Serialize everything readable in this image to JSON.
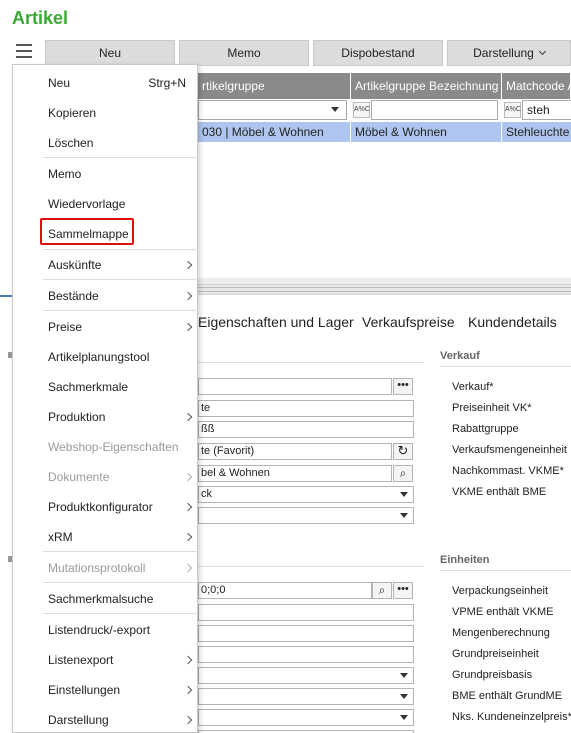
{
  "app": {
    "title": "Artikel"
  },
  "toolbar": {
    "buttons": [
      "Neu",
      "Memo",
      "Dispobestand",
      "Darstellung"
    ]
  },
  "grid": {
    "columns": [
      "rtikelgruppe",
      "Artikelgruppe Bezeichnung",
      "Matchcode Ar"
    ],
    "filter_prefix": "A%C",
    "filters": [
      "",
      "",
      "steh"
    ],
    "selected_row": [
      "030  |  Möbel & Wohnen",
      "Möbel & Wohnen",
      "Stehleuchte  ("
    ]
  },
  "tabs": [
    "Eigenschaften und Lager",
    "Verkaufspreise",
    "Kundendetails"
  ],
  "form": {
    "left_values": [
      "",
      "te",
      "ßß",
      "te  (Favorit)",
      "bel & Wohnen",
      "ck",
      "",
      "0;0;0",
      "",
      "",
      "",
      "",
      "",
      "",
      ""
    ],
    "verkauf": {
      "title": "Verkauf",
      "labels": [
        "Verkauf*",
        "Preiseinheit VK*",
        "Rabattgruppe",
        "Verkaufsmengeneinheit",
        "Nachkommast. VKME*",
        "VKME enthält BME"
      ]
    },
    "einheiten": {
      "title": "Einheiten",
      "labels": [
        "Verpackungseinheit",
        "VPME enthält VKME",
        "Mengenberechnung",
        "Grundpreiseinheit",
        "Grundpreisbasis",
        "BME enthält GrundME",
        "Nks. Kundeneinzelpreis*"
      ]
    }
  },
  "menu": {
    "items": [
      {
        "label": "Neu",
        "shortcut": "Strg+N"
      },
      {
        "label": "Kopieren"
      },
      {
        "label": "Löschen"
      },
      {
        "label": "Memo"
      },
      {
        "label": "Wiedervorlage"
      },
      {
        "label": "Sammelmappe"
      },
      {
        "label": "Auskünfte"
      },
      {
        "label": "Bestände"
      },
      {
        "label": "Preise"
      },
      {
        "label": "Artikelplanungstool"
      },
      {
        "label": "Sachmerkmale"
      },
      {
        "label": "Produktion"
      },
      {
        "label": "Webshop-Eigenschaften"
      },
      {
        "label": "Dokumente"
      },
      {
        "label": "Produktkonfigurator"
      },
      {
        "label": "xRM"
      },
      {
        "label": "Mutationsprotokoll"
      },
      {
        "label": "Sachmerkmalsuche"
      },
      {
        "label": "Listendruck/-export"
      },
      {
        "label": "Listenexport"
      },
      {
        "label": "Einstellungen"
      },
      {
        "label": "Darstellung"
      }
    ]
  },
  "colors": {
    "title_green": "#3aaa35",
    "grid_header": "#8a8a8a",
    "selected_row": "#aec6ef",
    "highlight_red": "#e01010"
  }
}
